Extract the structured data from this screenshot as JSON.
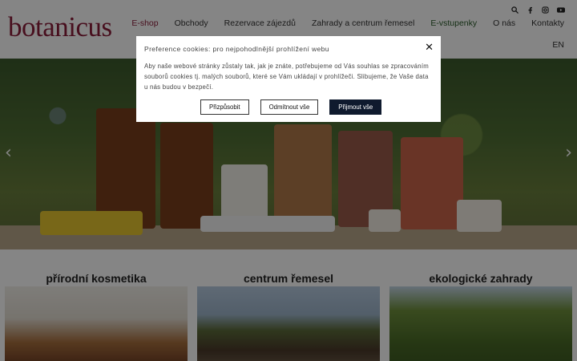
{
  "header": {
    "logo": "botanicus",
    "nav": [
      "E-shop",
      "Obchody",
      "Rezervace zájezdů",
      "Zahrady a centrum řemesel",
      "E-vstupenky",
      "O nás",
      "Kontakty"
    ],
    "language": "EN",
    "social_icons": [
      "search-icon",
      "facebook-icon",
      "instagram-icon",
      "youtube-icon"
    ]
  },
  "sections": [
    {
      "title": "přírodní kosmetika"
    },
    {
      "title": "centrum řemesel"
    },
    {
      "title": "ekologické zahrady"
    }
  ],
  "cookie": {
    "title": "Preference cookies: pro nejpohodlnější prohlížení webu",
    "text": "Aby naše webové stránky zůstaly tak, jak je znáte, potřebujeme od Vás souhlas se zpracováním souborů cookies tj. malých souborů, které se Vám ukládají v prohlížeči. Slibujeme, že Vaše data u nás budou v bezpečí.",
    "buttons": {
      "customize": "Přizpůsobit",
      "reject": "Odmítnout vše",
      "accept": "Přijmout vše"
    }
  },
  "colors": {
    "brand": "#8b1d3a",
    "accept_button": "#0f1a2e",
    "eshop": "#8b1d3a",
    "evstupenky": "#2a5a2a"
  }
}
